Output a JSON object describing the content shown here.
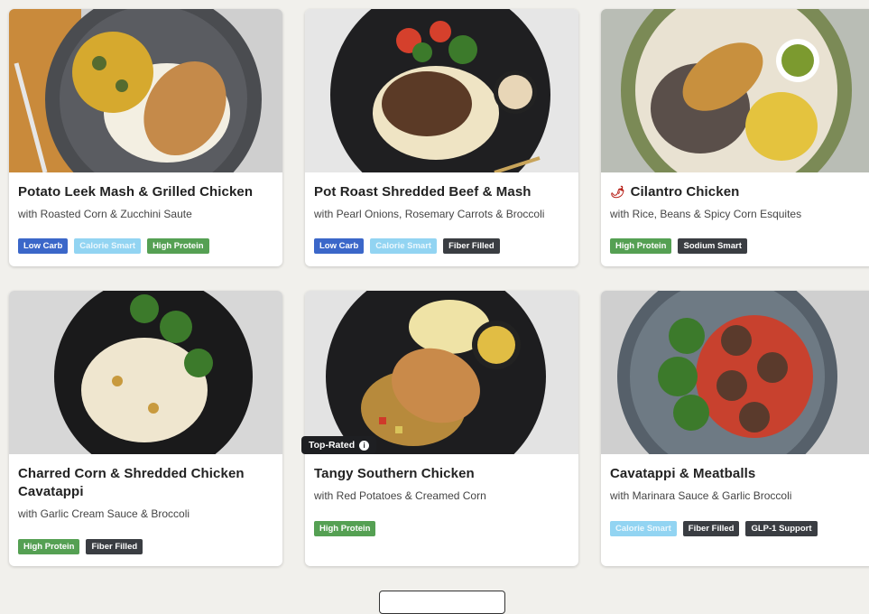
{
  "meals": [
    {
      "title": "Potato Leek Mash & Grilled Chicken",
      "subtitle": "with Roasted Corn & Zucchini Saute",
      "tags": [
        "Low Carb",
        "Calorie Smart",
        "High Protein"
      ]
    },
    {
      "title": "Pot Roast Shredded Beef & Mash",
      "subtitle": "with Pearl Onions, Rosemary Carrots & Broccoli",
      "tags": [
        "Low Carb",
        "Calorie Smart",
        "Fiber Filled"
      ]
    },
    {
      "title": "Cilantro Chicken",
      "subtitle": "with Rice, Beans & Spicy Corn Esquites",
      "tags": [
        "High Protein",
        "Sodium Smart"
      ],
      "spicy_icon": "chili-pepper-icon"
    },
    {
      "title": "Charred Corn & Shredded Chicken Cavatappi",
      "subtitle": "with Garlic Cream Sauce & Broccoli",
      "tags": [
        "High Protein",
        "Fiber Filled"
      ]
    },
    {
      "title": "Tangy Southern Chicken",
      "subtitle": "with Red Potatoes & Creamed Corn",
      "tags": [
        "High Protein"
      ],
      "badge": "Top-Rated"
    },
    {
      "title": "Cavatappi & Meatballs",
      "subtitle": "with Marinara Sauce & Garlic Broccoli",
      "tags": [
        "Calorie Smart",
        "Fiber Filled",
        "GLP-1 Support"
      ]
    }
  ],
  "colors": {
    "low_carb": "#3b67c9",
    "calorie_smart": "#92d4f2",
    "high_protein": "#55a053",
    "dark_tag": "#3a3d42",
    "background": "#f1f0ec"
  }
}
